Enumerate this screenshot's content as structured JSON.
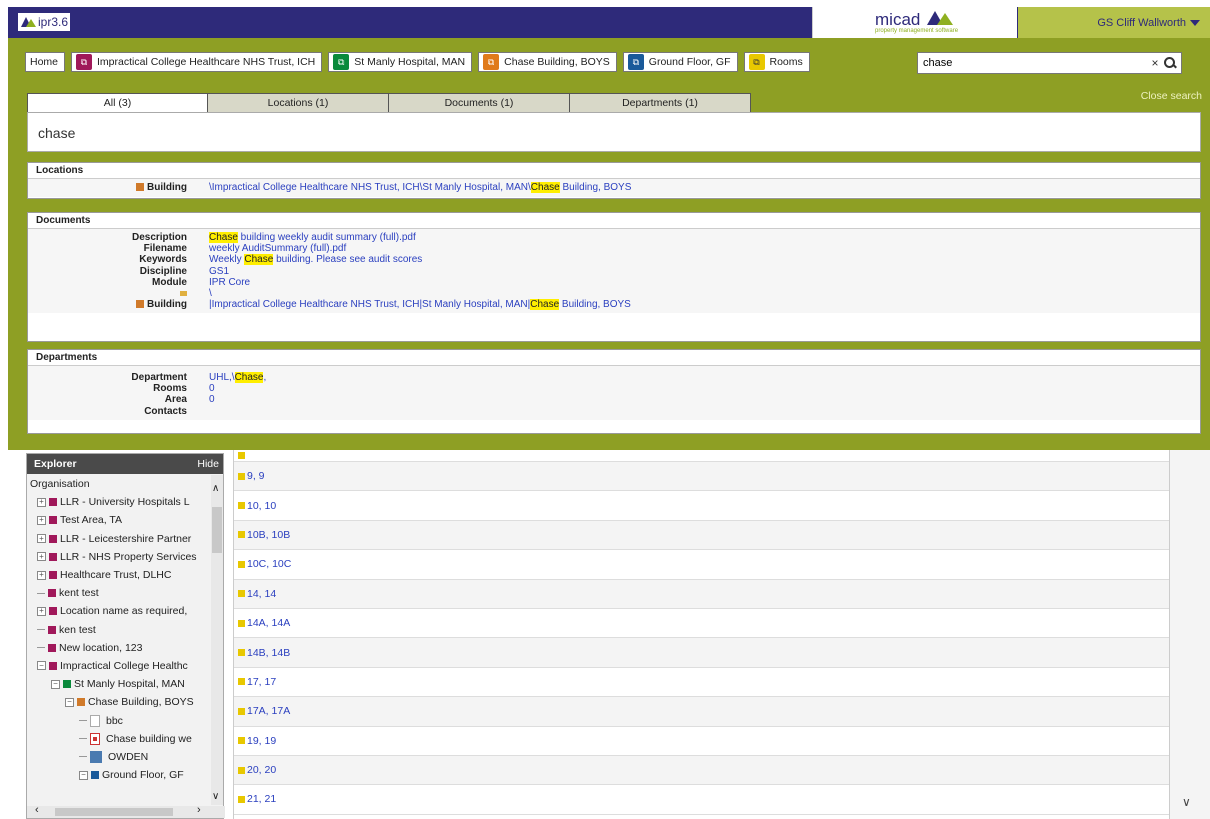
{
  "app": {
    "logo": "ipr3.6",
    "micad_logo": "micad",
    "micad_tagline": "property management software",
    "user": "GS Cliff Wallworth"
  },
  "breadcrumbs": [
    {
      "label": "Home",
      "icon": ""
    },
    {
      "label": "Impractical College Healthcare NHS Trust, ICH",
      "icon": "magenta"
    },
    {
      "label": "St Manly Hospital, MAN",
      "icon": "green"
    },
    {
      "label": "Chase Building, BOYS",
      "icon": "orange"
    },
    {
      "label": "Ground Floor, GF",
      "icon": "blue"
    },
    {
      "label": "Rooms",
      "icon": "yellow"
    }
  ],
  "search": {
    "value": "chase",
    "clear": "×",
    "close_label": "Close search"
  },
  "tabs": [
    {
      "label": "All (3)",
      "active": true
    },
    {
      "label": "Locations (1)",
      "active": false
    },
    {
      "label": "Documents (1)",
      "active": false
    },
    {
      "label": "Departments (1)",
      "active": false
    }
  ],
  "query_text": "chase",
  "locations": {
    "title": "Locations",
    "building_key": "Building",
    "building_pre": "\\Impractical College Healthcare NHS Trust, ICH\\St Manly Hospital, MAN\\",
    "building_hl": "Chase",
    "building_post": " Building, BOYS"
  },
  "documents": {
    "title": "Documents",
    "description_key": "Description",
    "description_hl": "Chase",
    "description_post": " building weekly audit summary (full).pdf",
    "filename_key": "Filename",
    "filename": "weekly AuditSummary (full).pdf",
    "keywords_key": "Keywords",
    "keywords_pre": "Weekly ",
    "keywords_hl": "Chase",
    "keywords_post": " building. Please see audit scores",
    "discipline_key": "Discipline",
    "discipline": "GS1",
    "module_key": "Module",
    "module": "IPR Core",
    "folder_value": "\\",
    "building_key": "Building",
    "building_pre": "|Impractical College Healthcare NHS Trust, ICH|St Manly Hospital, MAN|",
    "building_hl": "Chase",
    "building_post": " Building, BOYS"
  },
  "departments": {
    "title": "Departments",
    "department_key": "Department",
    "department_pre": "UHL,\\",
    "department_hl": "Chase",
    "department_post": ",",
    "rooms_key": "Rooms",
    "rooms": "0",
    "area_key": "Area",
    "area": "0",
    "contacts_key": "Contacts"
  },
  "explorer": {
    "title": "Explorer",
    "hide_label": "Hide",
    "root_label": "Organisation",
    "items": [
      {
        "label": "LLR - University Hospitals L",
        "color": "magenta",
        "expander": "+",
        "indent": 0
      },
      {
        "label": "Test Area, TA",
        "color": "magenta",
        "expander": "+",
        "indent": 0
      },
      {
        "label": "LLR - Leicestershire Partner",
        "color": "magenta",
        "expander": "+",
        "indent": 0
      },
      {
        "label": "LLR - NHS Property Services",
        "color": "magenta",
        "expander": "+",
        "indent": 0
      },
      {
        "label": "Healthcare Trust, DLHC",
        "color": "magenta",
        "expander": "+",
        "indent": 0
      },
      {
        "label": "kent test",
        "color": "magenta",
        "expander": "",
        "indent": 0
      },
      {
        "label": "Location name as required,",
        "color": "magenta",
        "expander": "+",
        "indent": 0
      },
      {
        "label": "ken test",
        "color": "magenta",
        "expander": "",
        "indent": 0
      },
      {
        "label": "New location, 123",
        "color": "magenta",
        "expander": "",
        "indent": 0
      },
      {
        "label": "Impractical College Healthc",
        "color": "magenta",
        "expander": "−",
        "indent": 0
      },
      {
        "label": "St Manly Hospital, MAN",
        "color": "green",
        "expander": "−",
        "indent": 1
      },
      {
        "label": "Chase Building, BOYS",
        "color": "orange",
        "expander": "−",
        "indent": 2
      },
      {
        "label": "bbc",
        "color": "file",
        "expander": "",
        "indent": 3
      },
      {
        "label": "Chase building we",
        "color": "pdf",
        "expander": "",
        "indent": 3
      },
      {
        "label": "OWDEN",
        "color": "group",
        "expander": "",
        "indent": 3
      },
      {
        "label": "Ground Floor, GF",
        "color": "blue",
        "expander": "−",
        "indent": 3
      }
    ]
  },
  "rooms_list": [
    "9, 9",
    "10, 10",
    "10B, 10B",
    "10C, 10C",
    "14, 14",
    "14A, 14A",
    "14B, 14B",
    "17, 17",
    "17A, 17A",
    "19, 19",
    "20, 20",
    "21, 21"
  ],
  "colors": {
    "header": "#2e2a7a",
    "overlay": "#8e9f24",
    "user_bar": "#b5c24a",
    "highlight": "#ffee00",
    "link": "#2a3fbf"
  }
}
